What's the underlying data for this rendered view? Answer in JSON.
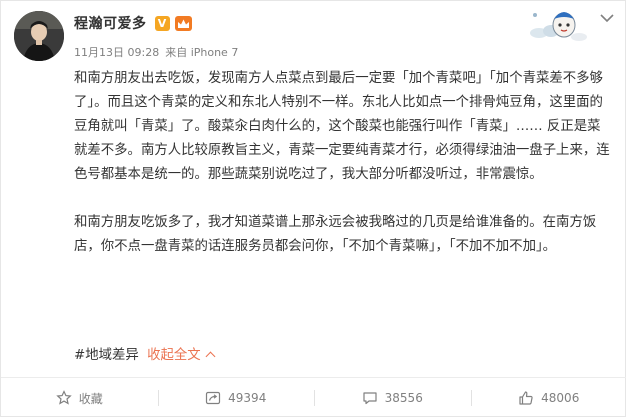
{
  "post": {
    "author": "程瀚可爱多",
    "verified_badge": "V",
    "meta": {
      "date": "11月13日 09:28",
      "source": "来自 iPhone 7"
    },
    "paragraphs": [
      "和南方朋友出去吃饭，发现南方人点菜点到最后一定要「加个青菜吧」「加个青菜差不多够了」。而且这个青菜的定义和东北人特别不一样。东北人比如点一个排骨炖豆角，这里面的豆角就叫「青菜」了。酸菜汆白肉什么的，这个酸菜也能强行叫作「青菜」…… 反正是菜就差不多。南方人比较原教旨主义，青菜一定要纯青菜才行，必须得绿油油一盘子上来，连色号都基本是统一的。那些蔬菜别说吃过了，我大部分听都没听过，非常震惊。",
      "和南方朋友吃饭多了，我才知道菜谱上那永远会被我略过的几页是给谁准备的。在南方饭店，你不点一盘青菜的话连服务员都会问你，「不加个青菜嘛」，「不加不加不加」。"
    ],
    "tag": "#地域差异",
    "collapse_label": "收起全文"
  },
  "actions": {
    "favorite_label": "收藏",
    "repost_count": "49394",
    "comment_count": "38556",
    "like_count": "48006"
  },
  "colors": {
    "accent": "#eb7350",
    "verified": "#f5a623",
    "text": "#333333",
    "meta": "#808080"
  }
}
